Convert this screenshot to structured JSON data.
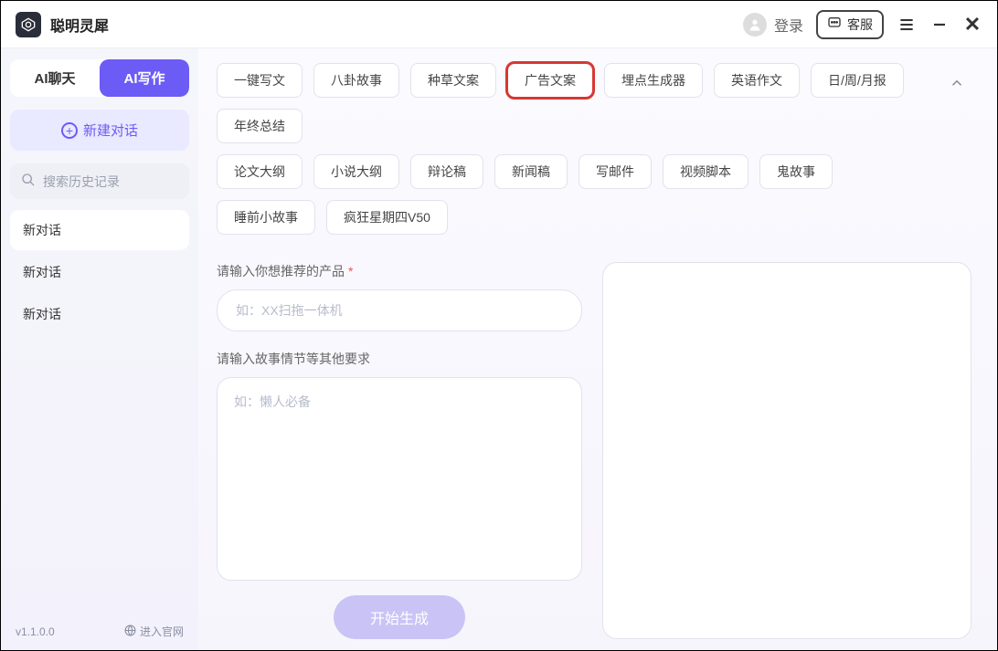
{
  "titlebar": {
    "app_name": "聪明灵犀",
    "login_label": "登录",
    "support_label": "客服"
  },
  "sidebar": {
    "tabs": {
      "chat": "AI聊天",
      "write": "AI写作"
    },
    "new_chat": "新建对话",
    "search_placeholder": "搜索历史记录",
    "history": [
      "新对话",
      "新对话",
      "新对话"
    ],
    "version": "v1.1.0.0",
    "official_link": "进入官网"
  },
  "tags": {
    "row1": [
      "一键写文",
      "八卦故事",
      "种草文案",
      "广告文案",
      "埋点生成器",
      "英语作文",
      "日/周/月报",
      "年终总结"
    ],
    "row2": [
      "论文大纲",
      "小说大纲",
      "辩论稿",
      "新闻稿",
      "写邮件",
      "视频脚本",
      "鬼故事",
      "睡前小故事",
      "疯狂星期四V50"
    ],
    "selected": "广告文案"
  },
  "form": {
    "product_label": "请输入你想推荐的产品",
    "product_placeholder": "如：XX扫拖一体机",
    "extra_label": "请输入故事情节等其他要求",
    "extra_placeholder": "如：懒人必备",
    "generate": "开始生成"
  }
}
